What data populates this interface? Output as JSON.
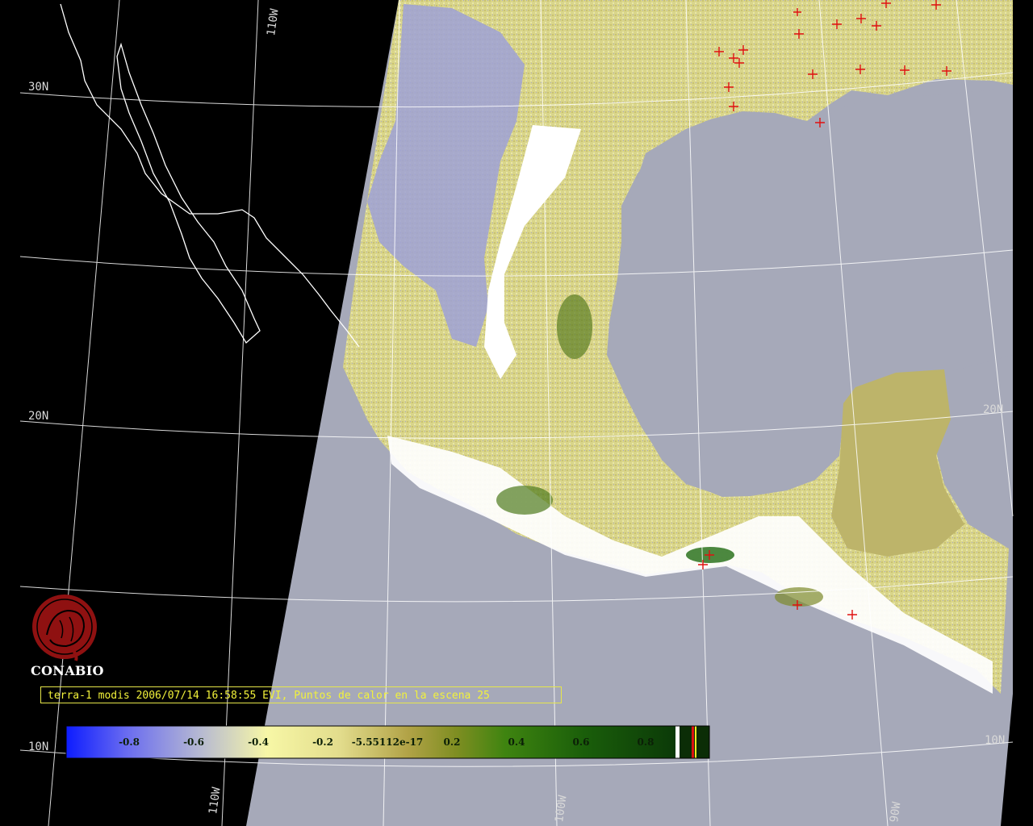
{
  "logo": {
    "name": "CONABIO",
    "icon": "conabio-seal-icon",
    "color": "#8f1111"
  },
  "title": "terra-1 modis 2006/07/14 16:58:55 EVI, Puntos de calor en la escena 25",
  "graticule": {
    "latitudes": [
      "30N",
      "20N",
      "20N",
      "10N",
      "10N"
    ],
    "longitudes": [
      "110W",
      "110W",
      "100W",
      "90W"
    ]
  },
  "colorbar": {
    "labels": [
      "-0.8",
      "-0.6",
      "-0.4",
      "-0.2",
      "-5.55112e-17",
      "0.2",
      "0.4",
      "0.6",
      "0.8"
    ],
    "range": [
      -1,
      1
    ],
    "colors": {
      "low": "#0d1cff",
      "mid": "#f7f7a6",
      "high": "#0b3a08"
    }
  },
  "colors": {
    "sea": "#a6a9b9",
    "land_outline": "#ffffff",
    "hotspot": "#e01010",
    "space": "#000000"
  }
}
